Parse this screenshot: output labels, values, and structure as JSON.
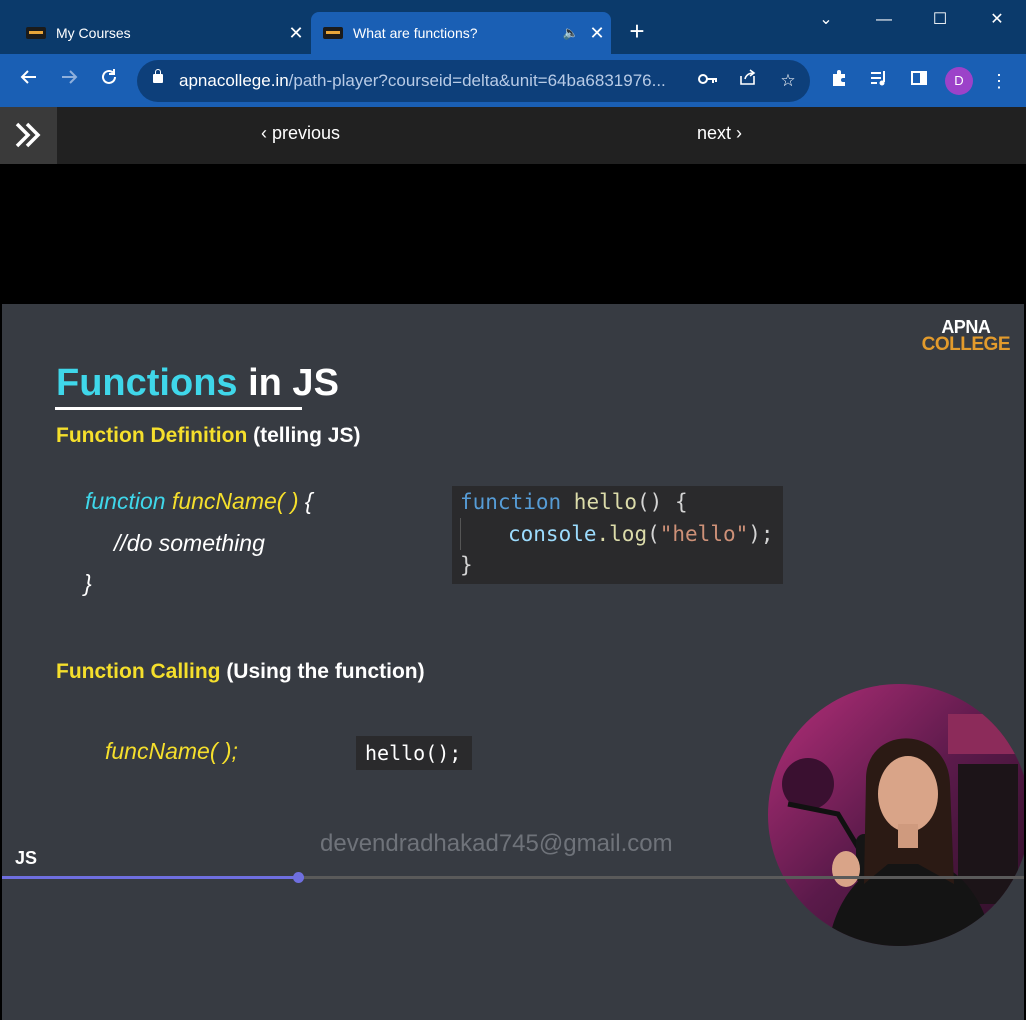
{
  "tabs": [
    {
      "title": "My Courses",
      "active": false
    },
    {
      "title": "What are functions?",
      "active": true,
      "audio_playing": true
    }
  ],
  "window_controls": {
    "dropdown": "⌄",
    "minimize": "—",
    "maximize": "☐",
    "close": "✕"
  },
  "address_bar": {
    "domain": "apnacollege.in",
    "path": "/path-player?courseid=delta&unit=64ba6831976..."
  },
  "profile_initial": "D",
  "player_nav": {
    "previous": "previous",
    "next": "next"
  },
  "slide": {
    "logo_line1": "APNA",
    "logo_line2": "COLLEGE",
    "title_part1": "Functions",
    "title_part2": " in JS",
    "definition_heading_yellow": "Function Definition",
    "definition_heading_white": " (telling JS)",
    "syntax_keyword": "function",
    "syntax_name": " funcName( )",
    "syntax_brace_open": " {",
    "syntax_body": "//do something",
    "syntax_brace_close": "}",
    "code_example": {
      "keyword": "function",
      "fn_name": " hello",
      "paren_brace": "() {",
      "console": "console",
      "dot_log": ".log",
      "open": "(",
      "string": "\"hello\"",
      "close": ");",
      "closing_brace": "}"
    },
    "calling_heading_yellow": "Function Calling",
    "calling_heading_white": " (Using the function)",
    "call_syntax": "funcName( );",
    "call_example": "hello();",
    "watermark": "devendradhakad745@gmail.com",
    "corner_label": "JS"
  },
  "progress": {
    "fraction": 0.29
  },
  "colors": {
    "accent_cyan": "#3fd7ea",
    "accent_yellow": "#f5df2c",
    "logo_orange": "#e39b2c",
    "progress": "#6f6fe0"
  },
  "icons": [
    "back-arrow-icon",
    "forward-arrow-icon",
    "reload-icon",
    "lock-icon",
    "key-icon",
    "share-icon",
    "star-icon",
    "extensions-icon",
    "media-control-icon",
    "side-panel-icon",
    "kebab-menu-icon",
    "expand-icon",
    "speaker-icon"
  ]
}
